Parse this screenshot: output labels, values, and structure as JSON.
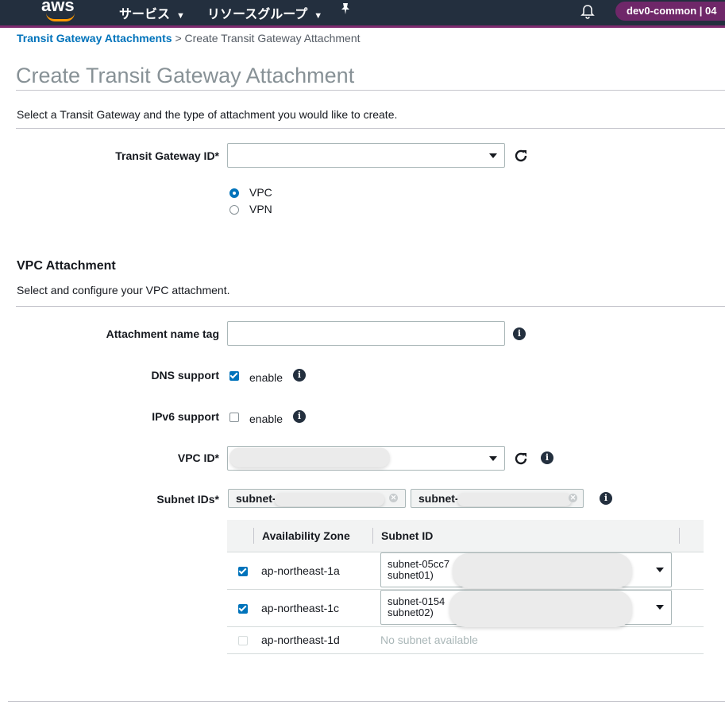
{
  "topbar": {
    "logo": "aws",
    "services_label": "サービス",
    "resource_groups_label": "リソースグループ",
    "account": "dev0-common  |  04"
  },
  "breadcrumb": {
    "parent": "Transit Gateway Attachments",
    "separator": ">",
    "current": "Create Transit Gateway Attachment"
  },
  "page": {
    "title": "Create Transit Gateway Attachment",
    "description": "Select a Transit Gateway and the type of attachment you would like to create."
  },
  "transit_gateway": {
    "label": "Transit Gateway ID*",
    "value": "",
    "attachment_types": [
      {
        "label": "VPC",
        "selected": true
      },
      {
        "label": "VPN",
        "selected": false
      }
    ]
  },
  "vpc_attachment": {
    "heading": "VPC Attachment",
    "description": "Select and configure your VPC attachment.",
    "name_tag_label": "Attachment name tag",
    "name_tag_value": "",
    "dns_label": "DNS support",
    "dns_enable": "enable",
    "dns_checked": true,
    "ipv6_label": "IPv6 support",
    "ipv6_enable": "enable",
    "ipv6_checked": false,
    "vpc_id_label": "VPC ID*",
    "subnet_ids_label": "Subnet IDs*",
    "subnet_tokens": [
      "subnet-",
      "subnet-"
    ]
  },
  "subnet_table": {
    "headers": [
      "Availability Zone",
      "Subnet ID"
    ],
    "rows": [
      {
        "az": "ap-northeast-1a",
        "checked": true,
        "subnet_line1": "subnet-05cc7",
        "subnet_line1_tail": "-",
        "subnet_line2": "subnet01)"
      },
      {
        "az": "ap-northeast-1c",
        "checked": true,
        "subnet_line1": "subnet-0154",
        "subnet_line1_tail": "",
        "subnet_line2": "subnet02)"
      },
      {
        "az": "ap-northeast-1d",
        "checked": false,
        "no_subnet": "No subnet available"
      }
    ]
  },
  "icons": {
    "refresh": "refresh-icon",
    "info": "info-icon",
    "bell": "bell-icon",
    "pin": "pin-icon"
  },
  "colors": {
    "topbar": "#232f3e",
    "accent": "#0073bb",
    "account_badge": "#6f2769",
    "orange": "#ff9900"
  }
}
